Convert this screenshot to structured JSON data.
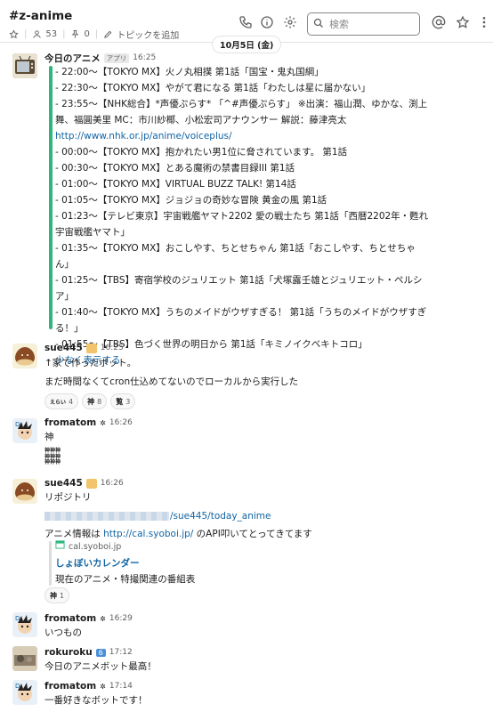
{
  "header": {
    "channel_name": "#z-anime",
    "member_count": "53",
    "pinned_count": "0",
    "add_topic": "トピックを追加",
    "search_placeholder": "検索"
  },
  "date_divider": "10月5日 (金)",
  "messages": [
    {
      "name": "今日のアニメ",
      "badge": "アプリ",
      "time": "16:25",
      "lines": [
        "- 22:00～【TOKYO MX】火ノ丸相撲 第1話「国宝・鬼丸国綱」",
        "- 22:30～【TOKYO MX】やがて君になる 第1話「わたしは星に届かない」",
        "- 23:55～【NHK総合】*声優ぷらす* 「^#声優ぷらす」 ※出演：福山潤、ゆかな、渕上",
        "舞、福圓美里 MC：市川紗椰、小松宏司アナウンサー 解説：藤津亮太",
        "http://www.nhk.or.jp/anime/voiceplus/",
        "- 00:00～【TOKYO MX】抱かれたい男1位に脅されています。 第1話",
        "- 00:30～【TOKYO MX】とある魔術の禁書目録III 第1話",
        "- 01:00～【TOKYO MX】VIRTUAL BUZZ TALK! 第14話",
        "- 01:05～【TOKYO MX】ジョジョの奇妙な冒険 黄金の風 第1話",
        "- 01:23～【テレビ東京】宇宙戦艦ヤマト2202 愛の戦士たち 第1話「西暦2202年・甦れ",
        "宇宙戦艦ヤマト」",
        "- 01:35～【TOKYO MX】おこしやす、ちとせちゃん 第1話「おこしやす、ちとせちゃ",
        "ん」",
        "- 01:25～【TBS】寄宿学校のジュリエット 第1話「犬塚露壬雄とジュリエット・ペルシ",
        "ア」",
        "- 01:40～【TOKYO MX】うちのメイドがウザすぎる！ 第1話「うちのメイドがウザすぎ",
        "る！」",
        "- 01:55～【TBS】色づく世界の明日から 第1話「キミノイクベキトコロ」"
      ],
      "show_less": "少なく表示する"
    },
    {
      "name": "sue445",
      "time": "16:25",
      "lines": [
        "↑家で作ったボット。",
        "まだ時間なくてcron仕込めてないのでローカルから実行した"
      ],
      "reactions": [
        {
          "emoji": "えらい",
          "count": "4"
        },
        {
          "emoji": "神",
          "count": "8"
        },
        {
          "emoji": "覧",
          "count": "3"
        }
      ]
    },
    {
      "name": "fromatom",
      "time": "16:26",
      "lines": [
        "神",
        "神神神",
        "神神神",
        "神神神"
      ]
    },
    {
      "name": "sue445",
      "time": "16:26",
      "lines": [
        "リポジトリ",
        "/sue445/today_anime",
        "アニメ情報は ",
        "http://cal.syoboi.jp/",
        " のAPI叩いてとってきてます"
      ],
      "unfurl": {
        "site": "cal.syoboi.jp",
        "title": "しょぼいカレンダー",
        "desc": "現在のアニメ・特撮関連の番組表"
      },
      "reactions": [
        {
          "emoji": "神",
          "count": "1"
        }
      ]
    },
    {
      "name": "fromatom",
      "time": "16:29",
      "lines": [
        "いつもの"
      ]
    },
    {
      "name": "rokuroku",
      "badge_num": "6",
      "time": "17:12",
      "lines": [
        "今日のアニメボット最高！"
      ]
    },
    {
      "name": "fromatom",
      "time": "17:14",
      "lines": [
        "一番好きなボットです！"
      ]
    }
  ],
  "colors": {
    "accent_green": "#2eb67d",
    "link_blue": "#1264a3",
    "text": "#1d1c1d",
    "muted": "#616061"
  }
}
